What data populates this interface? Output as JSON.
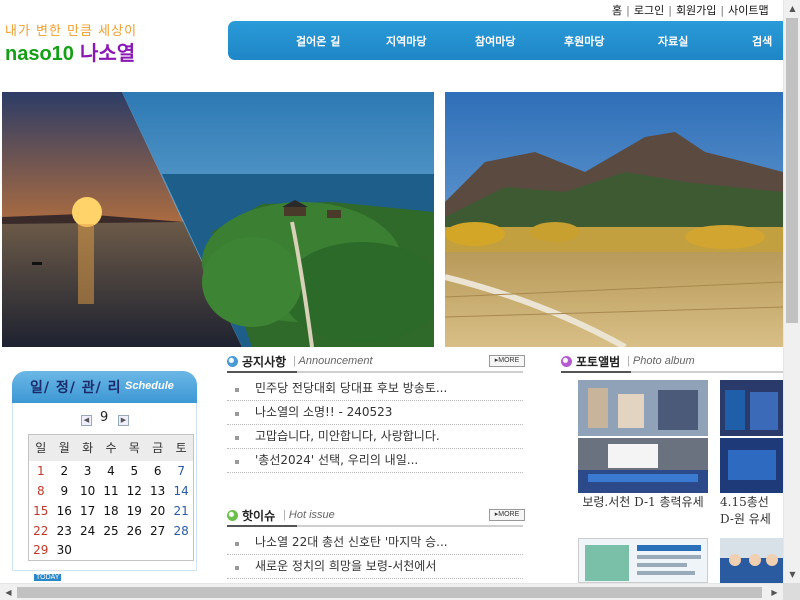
{
  "top_links": [
    "홈",
    "로그인",
    "회원가입",
    "사이트맵"
  ],
  "slogan": "내가 변한 만큼 세상이",
  "logo": {
    "en": "naso10",
    "ko": "나소열"
  },
  "nav": [
    "걸어온 길",
    "지역마당",
    "참여마당",
    "후원마당",
    "자료실",
    "검색"
  ],
  "schedule": {
    "title": "일/ 정/ 관/ 리",
    "subtitle": "Schedule",
    "month": "9",
    "weekdays": [
      "일",
      "월",
      "화",
      "수",
      "목",
      "금",
      "토"
    ],
    "weeks": [
      [
        "1",
        "2",
        "3",
        "4",
        "5",
        "6",
        "7"
      ],
      [
        "8",
        "9",
        "10",
        "11",
        "12",
        "13",
        "14"
      ],
      [
        "15",
        "16",
        "17",
        "18",
        "19",
        "20",
        "21"
      ],
      [
        "22",
        "23",
        "24",
        "25",
        "26",
        "27",
        "28"
      ],
      [
        "29",
        "30",
        "",
        "",
        "",
        "",
        ""
      ]
    ],
    "today_label": "TODAY"
  },
  "notice": {
    "title": "공지사항",
    "subtitle": "Announcement",
    "more": "▸MORE",
    "items": [
      "민주당 전당대회 당대표 후보 방송토...",
      "나소열의 소명!! - 240523",
      "고맙습니다, 미안합니다, 사랑합니다.",
      "'총선2024' 선택, 우리의 내일..."
    ]
  },
  "hot": {
    "title": "핫이슈",
    "subtitle": "Hot issue",
    "more": "▸MORE",
    "items": [
      "나소열 22대 총선 신호탄 '마지막 승...",
      "새로운 정치의 희망을 보령-서천에서"
    ]
  },
  "photo": {
    "title": "포토앨범",
    "subtitle": "Photo album",
    "captions": [
      "보령.서천 D-1 총력유세",
      "4.15총선 D-원 유세"
    ]
  },
  "colors": {
    "nav": "#2a9bd8",
    "logo_en": "#16a018",
    "logo_ko": "#8a18b4",
    "slogan": "#f0a030",
    "sunday": "#c0392b",
    "saturday": "#2a5aa8"
  }
}
